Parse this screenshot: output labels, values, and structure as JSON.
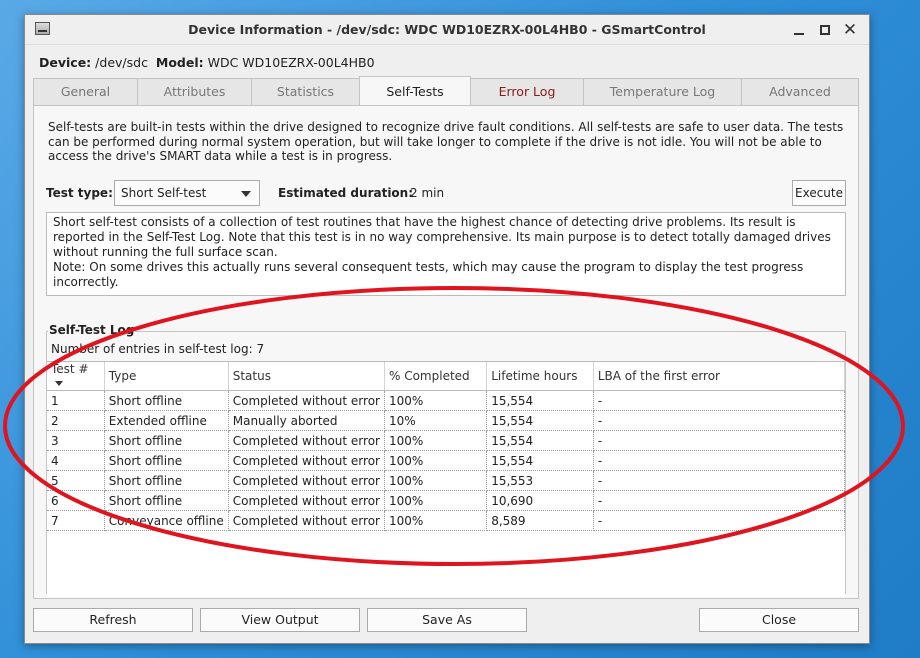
{
  "window": {
    "title": "Device Information - /dev/sdc: WDC WD10EZRX-00L4HB0 - GSmartControl"
  },
  "device": {
    "device_label": "Device:",
    "device_value": "/dev/sdc",
    "model_label": "Model:",
    "model_value": "WDC WD10EZRX-00L4HB0"
  },
  "tabs": [
    {
      "label": "General"
    },
    {
      "label": "Attributes"
    },
    {
      "label": "Statistics"
    },
    {
      "label": "Self-Tests"
    },
    {
      "label": "Error Log"
    },
    {
      "label": "Temperature Log"
    },
    {
      "label": "Advanced"
    }
  ],
  "active_tab": "Self-Tests",
  "selftests": {
    "intro": "Self-tests are built-in tests within the drive designed to recognize drive fault conditions. All self-tests are safe to user data. The tests can be performed during normal system operation, but will take longer to complete if the drive is not idle. You will not be able to access the drive's SMART data while a test is in progress.",
    "test_type_label": "Test type:",
    "test_type_value": "Short Self-test",
    "est_label": "Estimated duration:",
    "est_value": "2 min",
    "execute_label": "Execute",
    "desc_line1": "Short self-test consists of a collection of test routines that have the highest chance of detecting drive problems. Its result is reported in the Self-Test Log. Note that this test is in no way comprehensive. Its main purpose is to detect totally damaged drives without running the full surface scan.",
    "desc_line2": "Note: On some drives this actually runs several consequent tests, which may cause the program to display the test progress incorrectly."
  },
  "log": {
    "title": "Self-Test Log",
    "count_text": "Number of entries in self-test log: 7",
    "columns": [
      "Test #",
      "Type",
      "Status",
      "% Completed",
      "Lifetime hours",
      "LBA of the first error"
    ],
    "rows": [
      [
        "1",
        "Short offline",
        "Completed without error",
        "100%",
        "15,554",
        "-"
      ],
      [
        "2",
        "Extended offline",
        "Manually aborted",
        "10%",
        "15,554",
        "-"
      ],
      [
        "3",
        "Short offline",
        "Completed without error",
        "100%",
        "15,554",
        "-"
      ],
      [
        "4",
        "Short offline",
        "Completed without error",
        "100%",
        "15,554",
        "-"
      ],
      [
        "5",
        "Short offline",
        "Completed without error",
        "100%",
        "15,553",
        "-"
      ],
      [
        "6",
        "Short offline",
        "Completed without error",
        "100%",
        "10,690",
        "-"
      ],
      [
        "7",
        "Conveyance offline",
        "Completed without error",
        "100%",
        "8,589",
        "-"
      ]
    ]
  },
  "buttons": {
    "refresh": "Refresh",
    "view_output": "View Output",
    "save_as": "Save As",
    "close": "Close"
  },
  "colors": {
    "error_tab_text": "#8b1a1a",
    "annotation_ellipse": "#e0141e"
  }
}
